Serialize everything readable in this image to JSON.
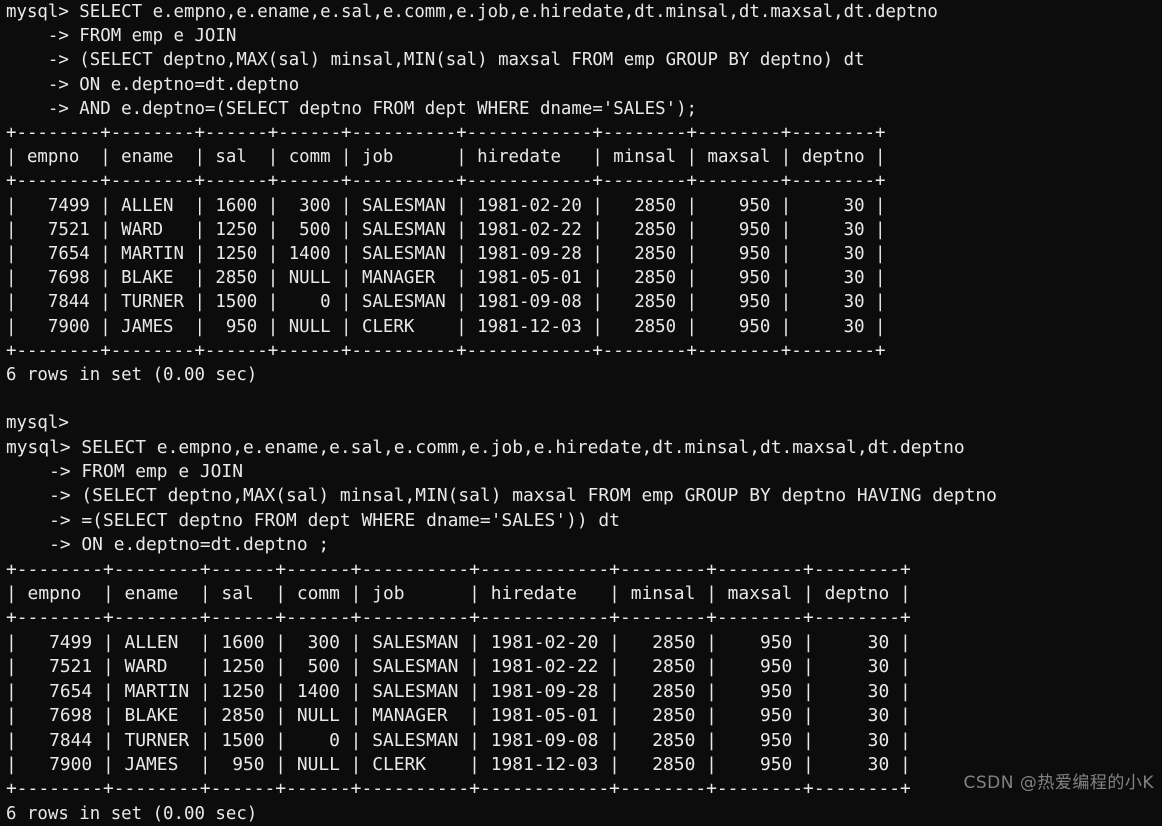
{
  "terminal": {
    "background_color": "#0c0c0c",
    "foreground_color": "#e9e9e9",
    "prompt": "mysql>",
    "continuation_prompt": "    ->"
  },
  "watermark": {
    "text": "CSDN @热爱编程的小K"
  },
  "blocks": [
    {
      "id": "block-1",
      "query_lines": [
        "mysql> SELECT e.empno,e.ename,e.sal,e.comm,e.job,e.hiredate,dt.minsal,dt.maxsal,dt.deptno",
        "    -> FROM emp e JOIN",
        "    -> (SELECT deptno,MAX(sal) minsal,MIN(sal) maxsal FROM emp GROUP BY deptno) dt",
        "    -> ON e.deptno=dt.deptno",
        "    -> AND e.deptno=(SELECT deptno FROM dept WHERE dname='SALES');"
      ],
      "table": {
        "separator": "+--------+--------+------+------+----------+------------+--------+--------+--------+",
        "header_row": "| empno  | ename  | sal  | comm | job      | hiredate   | minsal | maxsal | deptno |",
        "columns": [
          "empno",
          "ename",
          "sal",
          "comm",
          "job",
          "hiredate",
          "minsal",
          "maxsal",
          "deptno"
        ],
        "rows": [
          [
            "7499",
            "ALLEN",
            "1600",
            "300",
            "SALESMAN",
            "1981-02-20",
            "2850",
            "950",
            "30"
          ],
          [
            "7521",
            "WARD",
            "1250",
            "500",
            "SALESMAN",
            "1981-02-22",
            "2850",
            "950",
            "30"
          ],
          [
            "7654",
            "MARTIN",
            "1250",
            "1400",
            "SALESMAN",
            "1981-09-28",
            "2850",
            "950",
            "30"
          ],
          [
            "7698",
            "BLAKE",
            "2850",
            "NULL",
            "MANAGER",
            "1981-05-01",
            "2850",
            "950",
            "30"
          ],
          [
            "7844",
            "TURNER",
            "1500",
            "0",
            "SALESMAN",
            "1981-09-08",
            "2850",
            "950",
            "30"
          ],
          [
            "7900",
            "JAMES",
            "950",
            "NULL",
            "CLERK",
            "1981-12-03",
            "2850",
            "950",
            "30"
          ]
        ],
        "rendered_rows": [
          "|   7499 | ALLEN  | 1600 |  300 | SALESMAN | 1981-02-20 |   2850 |    950 |     30 |",
          "|   7521 | WARD   | 1250 |  500 | SALESMAN | 1981-02-22 |   2850 |    950 |     30 |",
          "|   7654 | MARTIN | 1250 | 1400 | SALESMAN | 1981-09-28 |   2850 |    950 |     30 |",
          "|   7698 | BLAKE  | 2850 | NULL | MANAGER  | 1981-05-01 |   2850 |    950 |     30 |",
          "|   7844 | TURNER | 1500 |    0 | SALESMAN | 1981-09-08 |   2850 |    950 |     30 |",
          "|   7900 | JAMES  |  950 | NULL | CLERK    | 1981-12-03 |   2850 |    950 |     30 |"
        ]
      },
      "status": "6 rows in set (0.00 sec)",
      "trailing_prompt": "mysql>"
    },
    {
      "id": "block-2",
      "query_lines": [
        "mysql> SELECT e.empno,e.ename,e.sal,e.comm,e.job,e.hiredate,dt.minsal,dt.maxsal,dt.deptno",
        "    -> FROM emp e JOIN",
        "    -> (SELECT deptno,MAX(sal) minsal,MIN(sal) maxsal FROM emp GROUP BY deptno HAVING deptno",
        "    -> =(SELECT deptno FROM dept WHERE dname='SALES')) dt",
        "    -> ON e.deptno=dt.deptno ;"
      ],
      "table": {
        "separator": "+--------+--------+------+------+----------+------------+--------+--------+--------+",
        "header_row": "| empno  | ename  | sal  | comm | job      | hiredate   | minsal | maxsal | deptno |",
        "columns": [
          "empno",
          "ename",
          "sal",
          "comm",
          "job",
          "hiredate",
          "minsal",
          "maxsal",
          "deptno"
        ],
        "rows": [
          [
            "7499",
            "ALLEN",
            "1600",
            "300",
            "SALESMAN",
            "1981-02-20",
            "2850",
            "950",
            "30"
          ],
          [
            "7521",
            "WARD",
            "1250",
            "500",
            "SALESMAN",
            "1981-02-22",
            "2850",
            "950",
            "30"
          ],
          [
            "7654",
            "MARTIN",
            "1250",
            "1400",
            "SALESMAN",
            "1981-09-28",
            "2850",
            "950",
            "30"
          ],
          [
            "7698",
            "BLAKE",
            "2850",
            "NULL",
            "MANAGER",
            "1981-05-01",
            "2850",
            "950",
            "30"
          ],
          [
            "7844",
            "TURNER",
            "1500",
            "0",
            "SALESMAN",
            "1981-09-08",
            "2850",
            "950",
            "30"
          ],
          [
            "7900",
            "JAMES",
            "950",
            "NULL",
            "CLERK",
            "1981-12-03",
            "2850",
            "950",
            "30"
          ]
        ],
        "rendered_rows": [
          "|   7499 | ALLEN  | 1600 |  300 | SALESMAN | 1981-02-20 |   2850 |    950 |     30 |",
          "|   7521 | WARD   | 1250 |  500 | SALESMAN | 1981-02-22 |   2850 |    950 |     30 |",
          "|   7654 | MARTIN | 1250 | 1400 | SALESMAN | 1981-09-28 |   2850 |    950 |     30 |",
          "|   7698 | BLAKE  | 2850 | NULL | MANAGER  | 1981-05-01 |   2850 |    950 |     30 |",
          "|   7844 | TURNER | 1500 |    0 | SALESMAN | 1981-09-08 |   2850 |    950 |     30 |",
          "|   7900 | JAMES  |  950 | NULL | CLERK    | 1981-12-03 |   2850 |    950 |     30 |"
        ]
      },
      "status": "6 rows in set (0.00 sec)"
    }
  ]
}
